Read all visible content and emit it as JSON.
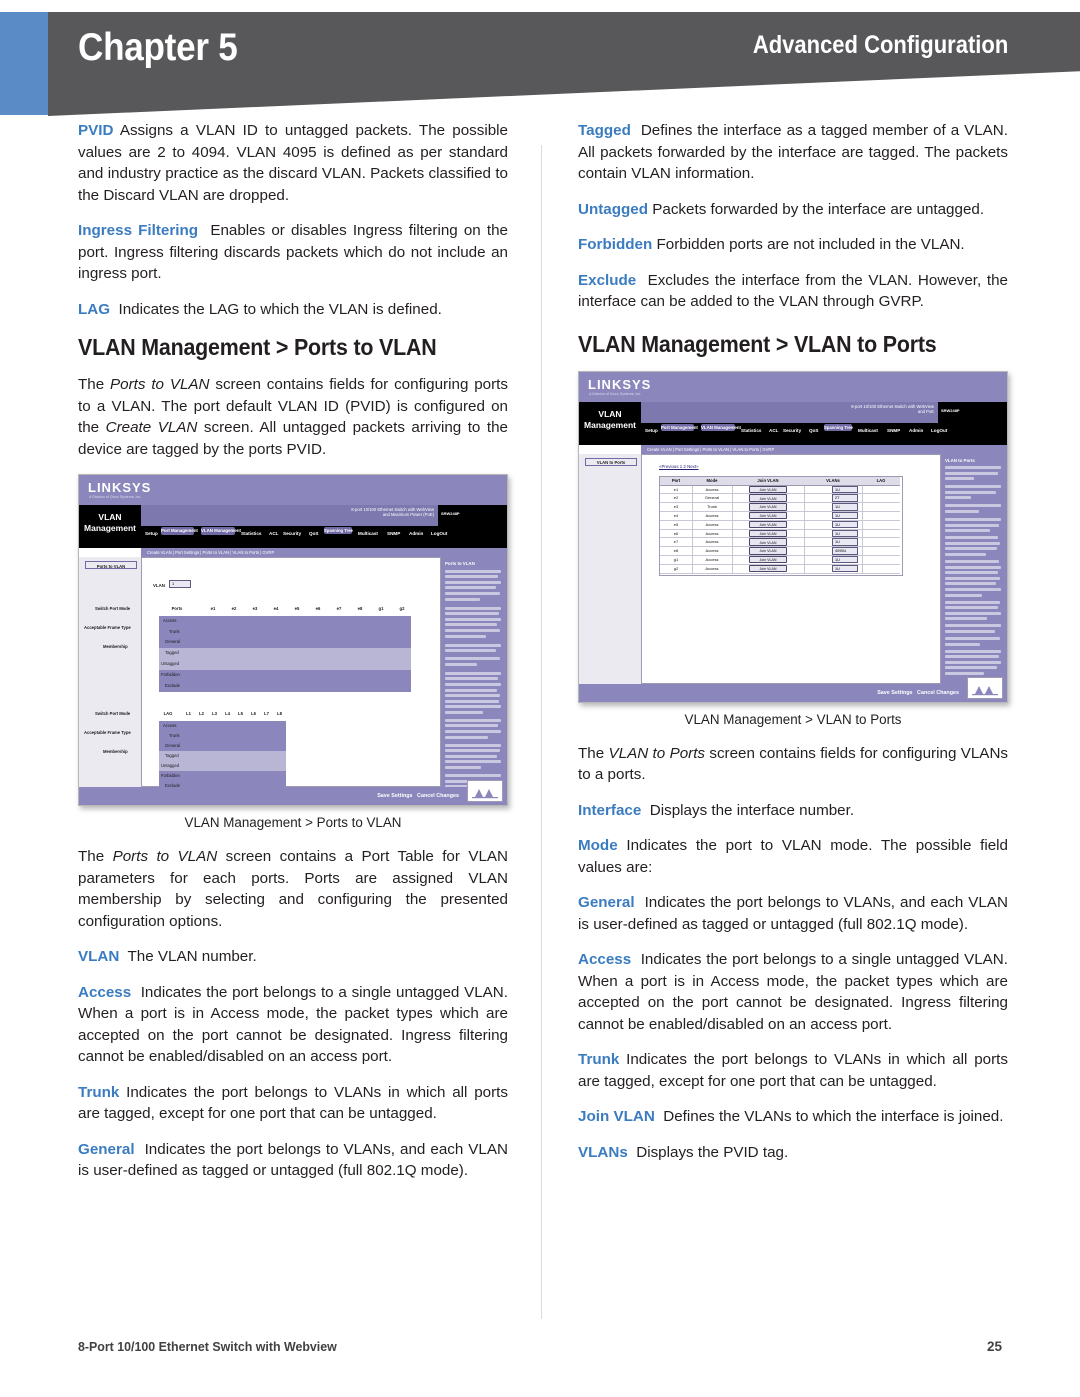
{
  "header": {
    "chapter_label": "Chapter 5",
    "section_title": "Advanced Configuration",
    "accent_blue": "#5b8bc6",
    "band_gray": "#58585a"
  },
  "footer": {
    "product": "8-Port 10/100 Ethernet Switch with Webview",
    "page_number": "25"
  },
  "left_column": {
    "para_pvid": {
      "term": "PVID",
      "text": "Assigns a VLAN ID to untagged packets. The possible values are 2 to 4094. VLAN 4095 is defined as per standard and industry practice as the discard VLAN. Packets classified to the Discard VLAN are dropped."
    },
    "para_ingress_filtering": {
      "term": "Ingress Filtering",
      "text": "Enables or disables Ingress filtering on the port. Ingress filtering discards packets which do not include an ingress port."
    },
    "para_lag": {
      "term": "LAG",
      "text": "Indicates the LAG to which the VLAN is defined."
    },
    "heading_ports_to_vlan": "VLAN Management > Ports to VLAN",
    "para_intro": {
      "t1": "The ",
      "i1": "Ports to VLAN",
      "t2": " screen contains fields for configuring ports to a VLAN. The port default VLAN ID (PVID) is configured on the ",
      "i2": "Create VLAN",
      "t3": " screen. All untagged packets arriving to the device are tagged by the ports PVID."
    },
    "figure_caption": "VLAN Management > Ports to VLAN",
    "para_porttable": {
      "t1": "The ",
      "i1": "Ports to VLAN",
      "t2": " screen contains a Port Table for VLAN parameters for each ports. Ports are assigned VLAN membership by selecting and configuring the presented configuration options."
    },
    "para_vlan": {
      "term": "VLAN",
      "text": "The VLAN number."
    },
    "para_access": {
      "term": "Access",
      "text": "Indicates the port belongs to a single untagged VLAN. When a port is in Access mode, the packet types which are accepted on the port cannot be designated. Ingress filtering cannot be enabled/disabled on an access port."
    },
    "para_trunk": {
      "term": "Trunk",
      "text": "Indicates the port belongs to VLANs in which all ports are tagged, except for one port that can be untagged."
    },
    "para_general": {
      "term": "General",
      "text": "Indicates the port belongs to VLANs, and each VLAN is user-defined as tagged or untagged (full 802.1Q mode)."
    }
  },
  "right_column": {
    "para_tagged": {
      "term": "Tagged",
      "text": "Defines the interface as a tagged member of a VLAN. All packets forwarded by the interface are tagged. The packets contain VLAN information."
    },
    "para_untagged": {
      "term": "Untagged",
      "text": "Packets forwarded by the interface are untagged."
    },
    "para_forbidden": {
      "term": "Forbidden",
      "text": "Forbidden ports are not included in the VLAN."
    },
    "para_exclude": {
      "term": "Exclude",
      "text": "Excludes the interface from the VLAN. However, the interface can be added to the VLAN through GVRP."
    },
    "heading_vlan_to_ports": "VLAN Management > VLAN to Ports",
    "figure_caption": "VLAN Management > VLAN to Ports",
    "para_intro": {
      "t1": "The ",
      "i1": "VLAN to Ports",
      "t2": " screen contains fields for configuring VLANs to a ports."
    },
    "para_interface": {
      "term": "Interface",
      "text": "Displays the interface number."
    },
    "para_mode": {
      "term": "Mode",
      "text": "Indicates the port to VLAN mode. The possible field values are:"
    },
    "para_general": {
      "term": "General",
      "text": "Indicates the port belongs to VLANs, and each VLAN is user-defined as tagged or untagged (full 802.1Q mode)."
    },
    "para_access": {
      "term": "Access",
      "text": "Indicates the port belongs to a single untagged VLAN. When a port is in Access mode, the packet types which are accepted on the port cannot be designated. Ingress filtering cannot be enabled/disabled on an access port."
    },
    "para_trunk": {
      "term": "Trunk",
      "text": "Indicates the port belongs to VLANs in which all ports are tagged, except for one port that can be untagged."
    },
    "para_join_vlan": {
      "term": "Join VLAN",
      "text": "Defines the VLANs to which the interface is joined."
    },
    "para_vlans": {
      "term": "VLANs",
      "text": "Displays the PVID tag."
    }
  },
  "screenshot_ports_to_vlan": {
    "brand": "LINKSYS",
    "brand_sub": "A Division of Cisco Systems, Inc.",
    "module_line1": "VLAN",
    "module_line2": "Management",
    "device_line1": "8-port 10/100 Ethernet Switch with WebView",
    "device_line2": "and Maximum Power (PoE)",
    "model": "SRW248P",
    "nav_tabs": [
      "Setup",
      "Port Management",
      "VLAN Management",
      "Statistics",
      "ACL",
      "Security",
      "QoS",
      "Spanning Tree",
      "Multicast",
      "SNMP",
      "Admin",
      "LogOut"
    ],
    "subnav": "Create VLAN  |  Port Settings  |  Ports to VLAN  |  VLAN to Ports  |  GVRP",
    "left_item": "Ports to VLAN",
    "vlan_field_label": "VLAN",
    "vlan_field_value": "1",
    "group1_labels": [
      "Switch Port Mode",
      "Acceptable Frame Type",
      "Membership"
    ],
    "group2_labels": [
      "Switch Port Mode",
      "Acceptable Frame Type",
      "Membership"
    ],
    "port_header": "Ports",
    "port_columns": [
      "e1",
      "e2",
      "e3",
      "e4",
      "e5",
      "e6",
      "e7",
      "e8",
      "g1",
      "g2"
    ],
    "lag_header": "LAG",
    "lag_columns": [
      "L1",
      "L2",
      "L3",
      "L4",
      "L5",
      "L6",
      "L7",
      "L8"
    ],
    "row_labels": [
      "Access",
      "Trunk",
      "General",
      "Tagged",
      "Untagged",
      "Forbidden",
      "Exclude"
    ],
    "right_panel_title": "Ports to VLAN",
    "save_settings": "Save Settings",
    "cancel_changes": "Cancel Changes"
  },
  "screenshot_vlan_to_ports": {
    "brand": "LINKSYS",
    "brand_sub": "A Division of Cisco Systems, Inc.",
    "module_line1": "VLAN",
    "module_line2": "Management",
    "device_line1": "8-port 10/100 Ethernet Switch with WebView",
    "device_line2": "and PoE",
    "model": "SRW248P",
    "nav_tabs": [
      "Setup",
      "Port Management",
      "VLAN Management",
      "Statistics",
      "ACL",
      "Security",
      "QoS",
      "Spanning Tree",
      "Multicast",
      "SNMP",
      "Admin",
      "LogOut"
    ],
    "subnav": "Create VLAN  |  Port Settings  |  Ports to VLAN  |  VLAN to Ports  |  GVRP",
    "left_item": "VLAN to Ports",
    "pager": "«Previous   1   2   Next»",
    "table_headers": [
      "Port",
      "Mode",
      "Join VLAN",
      "VLANs",
      "LAG"
    ],
    "table_rows": [
      {
        "port": "e1",
        "mode": "Access",
        "join": "Join VLAN",
        "vlans": "1U",
        "lag": ""
      },
      {
        "port": "e2",
        "mode": "General",
        "join": "Join VLAN",
        "vlans": "2T",
        "lag": ""
      },
      {
        "port": "e3",
        "mode": "Trunk",
        "join": "Join VLAN",
        "vlans": "1U",
        "lag": ""
      },
      {
        "port": "e4",
        "mode": "Access",
        "join": "Join VLAN",
        "vlans": "1U",
        "lag": ""
      },
      {
        "port": "e5",
        "mode": "Access",
        "join": "Join VLAN",
        "vlans": "1U",
        "lag": ""
      },
      {
        "port": "e6",
        "mode": "Access",
        "join": "Join VLAN",
        "vlans": "1U",
        "lag": ""
      },
      {
        "port": "e7",
        "mode": "Access",
        "join": "Join VLAN",
        "vlans": "1U",
        "lag": ""
      },
      {
        "port": "e8",
        "mode": "Access",
        "join": "Join VLAN",
        "vlans": "4095U",
        "lag": ""
      },
      {
        "port": "g1",
        "mode": "Access",
        "join": "Join VLAN",
        "vlans": "1U",
        "lag": ""
      },
      {
        "port": "g2",
        "mode": "Access",
        "join": "Join VLAN",
        "vlans": "1U",
        "lag": ""
      }
    ],
    "right_panel_title": "VLAN to Ports",
    "save_settings": "Save Settings",
    "cancel_changes": "Cancel Changes"
  }
}
